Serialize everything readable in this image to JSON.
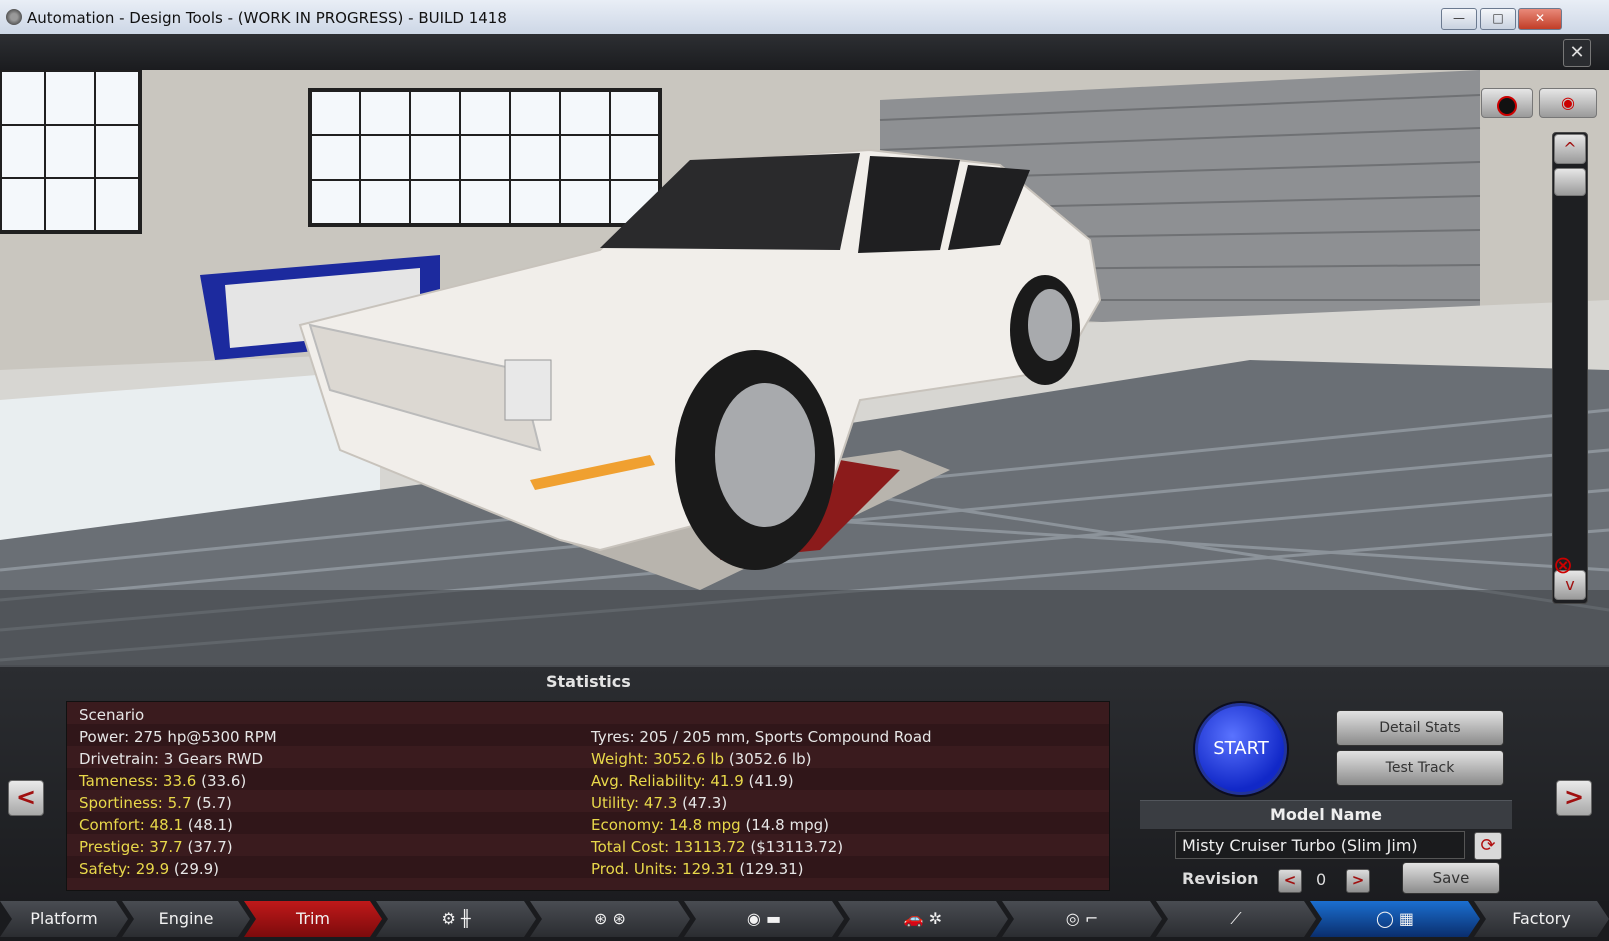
{
  "window": {
    "title": "Automation - Design Tools - (WORK IN PROGRESS) - BUILD 1418",
    "minimize": "—",
    "maximize": "□",
    "close": "✕"
  },
  "appbar": {
    "close": "✕"
  },
  "viewport_controls": {
    "camera_icon": "camera-icon",
    "eye_icon": "eye-icon",
    "up": "^",
    "down": "v"
  },
  "statistics": {
    "title": "Statistics",
    "scenario": "Scenario",
    "left": [
      {
        "label": "Power:",
        "value": "275 hp@5300 RPM",
        "extra": ""
      },
      {
        "label": "Drivetrain:",
        "value": "3 Gears RWD",
        "extra": ""
      },
      {
        "label": "Tameness:",
        "value": "33.6",
        "extra": "(33.6)"
      },
      {
        "label": "Sportiness:",
        "value": "5.7",
        "extra": "(5.7)"
      },
      {
        "label": "Comfort:",
        "value": "48.1",
        "extra": "(48.1)"
      },
      {
        "label": "Prestige:",
        "value": "37.7",
        "extra": "(37.7)"
      },
      {
        "label": "Safety:",
        "value": "29.9",
        "extra": "(29.9)"
      }
    ],
    "right": [
      {
        "label": "Tyres:",
        "value": "205 / 205 mm, Sports Compound Road",
        "extra": ""
      },
      {
        "label": "Weight:",
        "value": "3052.6 lb",
        "extra": "(3052.6 lb)"
      },
      {
        "label": "Avg. Reliability:",
        "value": "41.9",
        "extra": "(41.9)"
      },
      {
        "label": "Utility:",
        "value": "47.3",
        "extra": "(47.3)"
      },
      {
        "label": "Economy:",
        "value": "14.8 mpg",
        "extra": "(14.8 mpg)"
      },
      {
        "label": "Total Cost:",
        "value": "13113.72",
        "extra": "($13113.72)"
      },
      {
        "label": "Prod. Units:",
        "value": "129.31",
        "extra": "(129.31)"
      }
    ]
  },
  "nav": {
    "prev": "<",
    "next": ">"
  },
  "controls": {
    "start": "START",
    "detail_stats": "Detail Stats",
    "test_track": "Test Track",
    "model_name_label": "Model Name",
    "model_name_value": "Misty Cruiser Turbo (Slim Jim)",
    "revision_label": "Revision",
    "revision_value": "0",
    "rev_prev": "<",
    "rev_next": ">",
    "save": "Save"
  },
  "tabs": [
    {
      "label": "Platform"
    },
    {
      "label": "Engine"
    },
    {
      "label": "Trim"
    },
    {
      "label": "⚙ ╫"
    },
    {
      "label": "⊛ ⊛"
    },
    {
      "label": "◉ ▬"
    },
    {
      "label": "🚗 ✲"
    },
    {
      "label": "◎ ⌐"
    },
    {
      "label": "⟋"
    },
    {
      "label": "◯ ▦"
    },
    {
      "label": "Factory"
    }
  ]
}
